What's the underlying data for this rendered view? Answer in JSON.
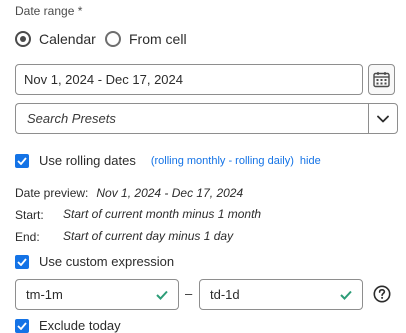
{
  "date_range": {
    "label": "Date range *",
    "options": [
      {
        "label": "Calendar",
        "selected": true
      },
      {
        "label": "From cell",
        "selected": false
      }
    ],
    "range_value": "Nov 1, 2024 - Dec 17, 2024",
    "calendar_icon": "calendar-icon",
    "presets_placeholder": "Search Presets",
    "presets_icon": "chevron-down-icon"
  },
  "rolling": {
    "checkbox_label": "Use rolling dates",
    "checked": true,
    "description": "(rolling monthly - rolling daily)",
    "hide_link": "hide"
  },
  "preview": {
    "label": "Date preview:",
    "value": "Nov 1, 2024 - Dec 17, 2024",
    "start_label": "Start:",
    "start_value": "Start of current month minus 1 month",
    "end_label": "End:",
    "end_value": "Start of current day minus 1 day"
  },
  "custom_expression": {
    "checkbox_label": "Use custom expression",
    "checked": true,
    "start_expr": "tm-1m",
    "separator": "–",
    "end_expr": "td-1d",
    "valid_icon": "checkmark-icon",
    "help_icon": "help-icon"
  },
  "exclude_today": {
    "checkbox_label": "Exclude today",
    "checked": true
  },
  "colors": {
    "accent": "#1473e6",
    "valid": "#2d9d78"
  }
}
